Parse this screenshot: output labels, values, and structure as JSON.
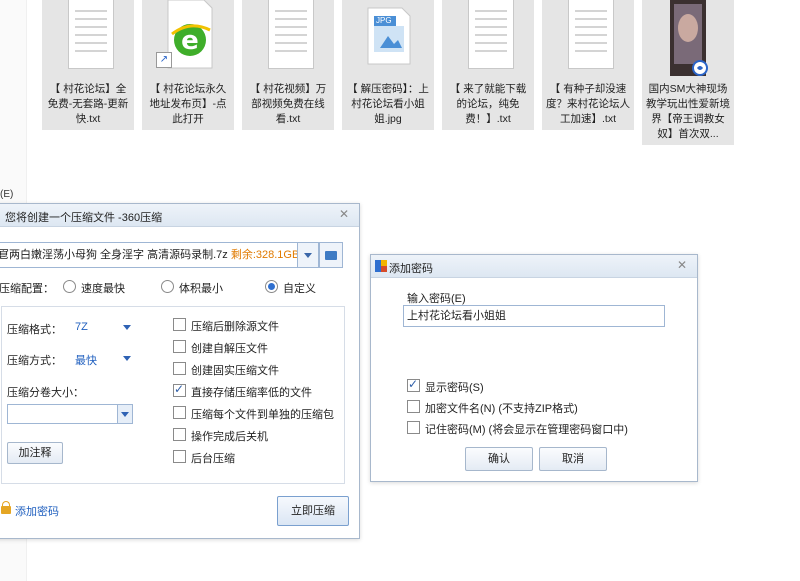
{
  "files": [
    {
      "caption": "【 村花论坛】全免费-无套路-更新快.txt",
      "type": "txt"
    },
    {
      "caption": "【 村花论坛永久地址发布页】-点此打开",
      "type": "ie-shortcut"
    },
    {
      "caption": "【 村花视频】万部视频免费在线看.txt",
      "type": "txt"
    },
    {
      "caption": "【 解压密码】：上村花论坛看小姐姐.jpg",
      "type": "jpg",
      "badge": "JPG"
    },
    {
      "caption": "【 来了就能下载的论坛，纯免费！】.txt",
      "type": "txt"
    },
    {
      "caption": "【 有种子却没速度？来村花论坛人工加速】.txt",
      "type": "txt"
    },
    {
      "caption": "国内SM大神现场教学玩出性爱新境界【帝王调教女奴】首次双...",
      "type": "video"
    }
  ],
  "stray_label": "(E)",
  "compress_dialog": {
    "title": "您将创建一个压缩文件 -360压缩",
    "path_text": "冟两白嫩淫荡小母狗 全身淫字 高清源码录制.7z ",
    "free_space": "剩余:328.1GB",
    "config_label": "压缩配置：",
    "options": [
      {
        "label": "速度最快",
        "checked": false
      },
      {
        "label": "体积最小",
        "checked": false
      },
      {
        "label": "自定义",
        "checked": true
      }
    ],
    "format_label": "压缩格式：",
    "format_value": "7Z",
    "method_label": "压缩方式：",
    "method_value": "最快",
    "split_label": "压缩分卷大小：",
    "comment_button": "加注释",
    "checks": [
      {
        "label": "压缩后删除源文件",
        "checked": false
      },
      {
        "label": "创建自解压文件",
        "checked": false
      },
      {
        "label": "创建固实压缩文件",
        "checked": false
      },
      {
        "label": "直接存储压缩率低的文件",
        "checked": true
      },
      {
        "label": "压缩每个文件到单独的压缩包",
        "checked": false
      },
      {
        "label": "操作完成后关机",
        "checked": false
      },
      {
        "label": "后台压缩",
        "checked": false
      }
    ],
    "add_password_link": "添加密码",
    "compress_button": "立即压缩"
  },
  "password_dialog": {
    "title": "添加密码",
    "input_label": "输入密码(E)",
    "input_value": "上村花论坛看小姐姐",
    "checks": [
      {
        "label": "显示密码(S)",
        "checked": true
      },
      {
        "label": "加密文件名(N) (不支持ZIP格式)",
        "checked": false
      },
      {
        "label": "记住密码(M) (将会显示在管理密码窗口中)",
        "checked": false
      }
    ],
    "ok_button": "确认",
    "cancel_button": "取消"
  },
  "colors": {
    "accent_blue": "#1f5fbf",
    "free_space_orange": "#e07a00",
    "ie_green": "#3fae2a"
  }
}
